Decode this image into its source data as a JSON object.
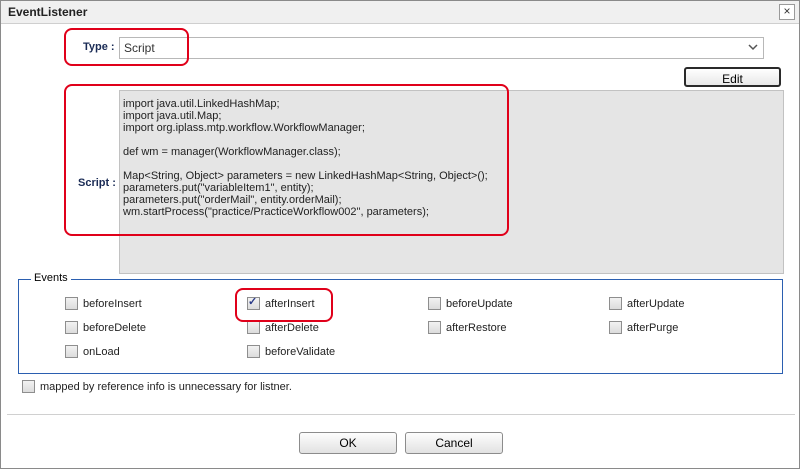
{
  "window": {
    "title": "EventListener",
    "close_symbol": "×"
  },
  "form": {
    "type_label": "Type :",
    "type_value": "Script",
    "edit_label": "Edit",
    "script_label": "Script :",
    "script_lines": [
      "import java.util.LinkedHashMap;",
      "import java.util.Map;",
      "import org.iplass.mtp.workflow.WorkflowManager;",
      "",
      "def wm = manager(WorkflowManager.class);",
      "",
      "Map<String, Object> parameters = new LinkedHashMap<String, Object>();",
      "parameters.put(\"variableItem1\", entity);",
      "parameters.put(\"orderMail\", entity.orderMail);",
      "wm.startProcess(\"practice/PracticeWorkflow002\", parameters);"
    ]
  },
  "events": {
    "legend": "Events",
    "items": [
      {
        "label": "beforeInsert",
        "checked": false
      },
      {
        "label": "afterInsert",
        "checked": true
      },
      {
        "label": "beforeUpdate",
        "checked": false
      },
      {
        "label": "afterUpdate",
        "checked": false
      },
      {
        "label": "beforeDelete",
        "checked": false
      },
      {
        "label": "afterDelete",
        "checked": false
      },
      {
        "label": "afterRestore",
        "checked": false
      },
      {
        "label": "afterPurge",
        "checked": false
      },
      {
        "label": "onLoad",
        "checked": false
      },
      {
        "label": "beforeValidate",
        "checked": false
      }
    ]
  },
  "mapped_option": {
    "label": "mapped by reference info is unnecessary for listner.",
    "checked": false
  },
  "footer": {
    "ok_label": "OK",
    "cancel_label": "Cancel"
  },
  "colors": {
    "highlight": "#e0001a",
    "fieldset_border": "#2b5fb0",
    "script_bg": "#e5e5e5"
  }
}
